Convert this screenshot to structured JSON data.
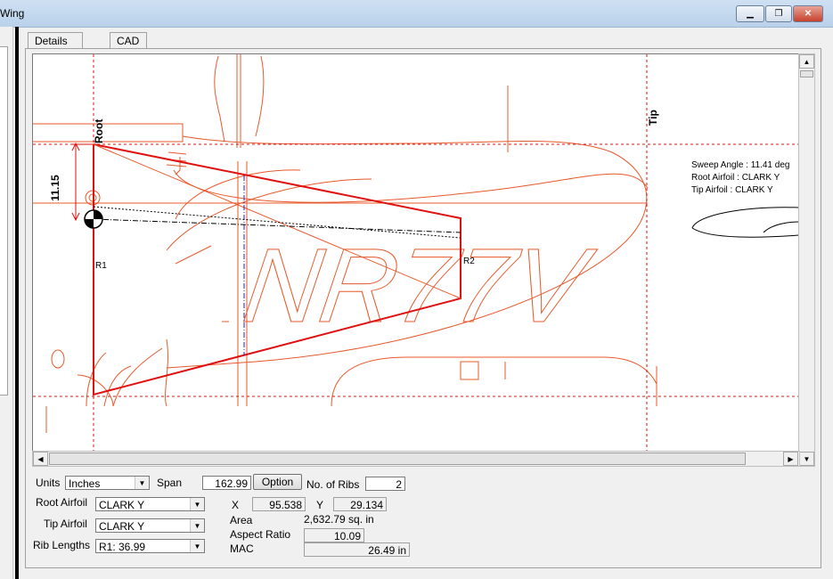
{
  "window": {
    "title": "Wing"
  },
  "tabs": [
    {
      "label": "Details"
    },
    {
      "label": "CAD"
    }
  ],
  "cad": {
    "root_label": "Root",
    "tip_label": "Tip",
    "dimension": "11.15",
    "r1_label": "R1",
    "r2_label": "R2",
    "registration": "NR77V",
    "info": {
      "sweep": "Sweep Angle : 11.41 deg",
      "root_airfoil": "Root Airfoil : CLARK Y",
      "tip_airfoil": "Tip Airfoil    : CLARK Y"
    }
  },
  "form": {
    "units_label": "Units",
    "units_value": "Inches",
    "span_label": "Span",
    "span_value": "162.99",
    "option_button": "Option",
    "ribs_label": "No. of Ribs",
    "ribs_value": "2",
    "root_airfoil_label": "Root Airfoil",
    "root_airfoil_value": "CLARK Y",
    "tip_airfoil_label": "Tip Airfoil",
    "tip_airfoil_value": "CLARK Y",
    "rib_lengths_label": "Rib Lengths",
    "rib_lengths_value": "R1: 36.99",
    "x_label": "X",
    "x_value": "95.538",
    "y_label": "Y",
    "y_value": "29.134",
    "area_label": "Area",
    "area_value": "2,632.79 sq. in",
    "aspect_label": "Aspect Ratio",
    "aspect_value": "10.09",
    "mac_label": "MAC",
    "mac_value": "26.49 in"
  },
  "colors": {
    "outline": "#e8582a",
    "wing": "#e01010",
    "guide": "#e01010",
    "chord": "#2020d0"
  }
}
